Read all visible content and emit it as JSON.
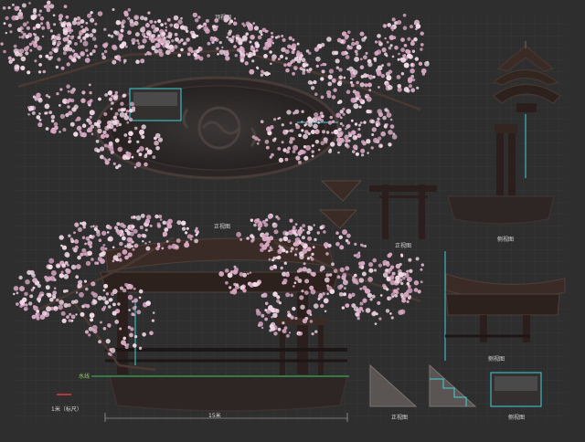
{
  "labels": {
    "top_view": "顶视图",
    "front_view": "正视图",
    "side_view_1": "侧视图",
    "front_view_2": "正视图",
    "side_view_2": "侧视图",
    "front_view_3": "正视图",
    "side_view_3": "侧视图",
    "ground_line": "水线",
    "scale": "1米（标尺）",
    "dimension": "15米"
  },
  "colors": {
    "background": "#2e2e2e",
    "grid": "#3d3d3d",
    "wood_dark": "#2a1f1c",
    "wood_mid": "#3a2b27",
    "blossom": "#d9a9c4",
    "blossom_light": "#f1d9e6",
    "cyan": "#3fd3d8",
    "green": "#32c85a"
  }
}
